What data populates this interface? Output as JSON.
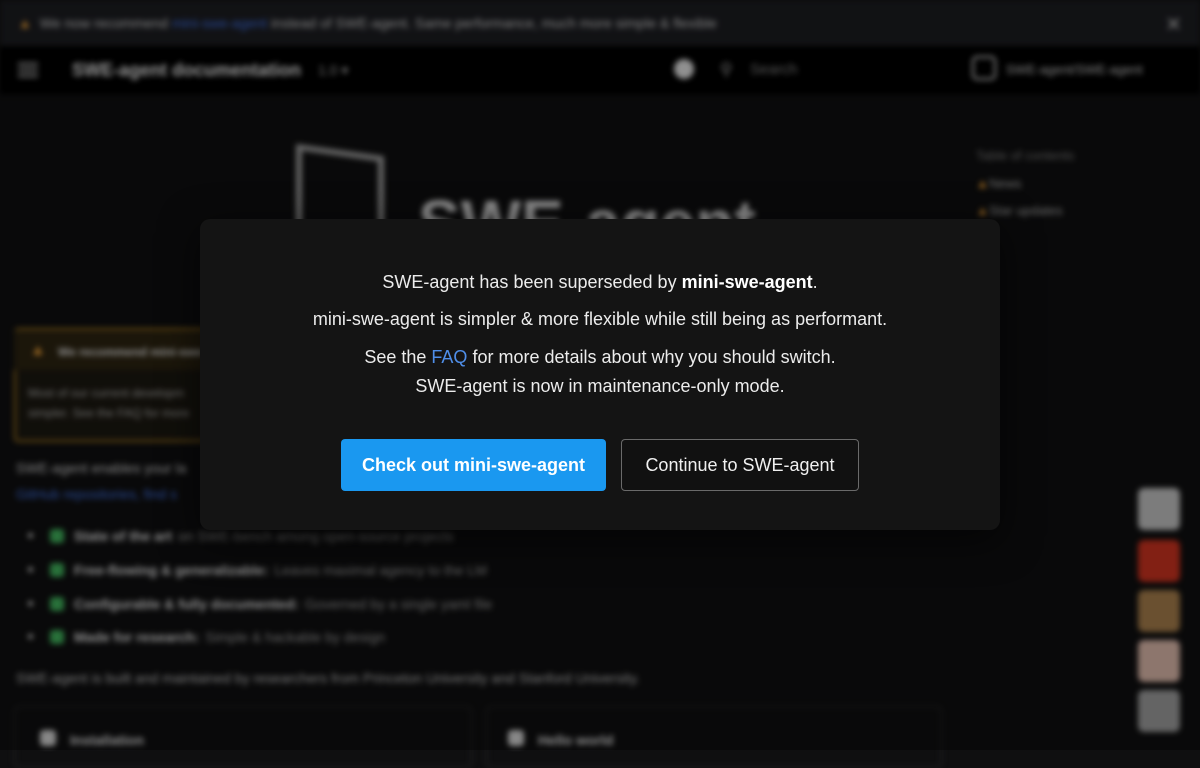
{
  "announcement": {
    "prefix": "We now recommend",
    "link": "mini-swe-agent",
    "suffix": "instead of SWE-agent. Same performance, much more simple & flexible",
    "close": "✕"
  },
  "header": {
    "title": "SWE-agent documentation",
    "version": "1.0 ▾",
    "search_placeholder": "Search",
    "repo": "SWE-agent/SWE-agent"
  },
  "hero": {
    "logo_text": "SWE-agent"
  },
  "toc": {
    "title": "Table of contents",
    "items": [
      "News",
      "Star updates"
    ]
  },
  "admonition": {
    "title": "We recommend mini-swe-agent",
    "line1": "Most of our current developm",
    "line2": "simpler. See the FAQ for more"
  },
  "intro": {
    "line1": "SWE-agent enables your la",
    "line2": "GitHub repositories, find s"
  },
  "features": [
    {
      "bold": "State of the art",
      "text": "on SWE-bench among open-source projects"
    },
    {
      "bold": "Free-flowing & generalizable:",
      "text": "Leaves maximal agency to the LM"
    },
    {
      "bold": "Configurable & fully documented:",
      "text": "Governed by a single yaml file"
    },
    {
      "bold": "Made for research:",
      "text": "Simple & hackable by design"
    }
  ],
  "built_by": "SWE-agent is built and maintained by researchers from Princeton University and Stanford University.",
  "cards": {
    "install": "Installation",
    "hello": "Hello world"
  },
  "modal": {
    "line1_pre": "SWE-agent has been superseded by ",
    "line1_bold": "mini-swe-agent",
    "line1_post": ".",
    "line2": "mini-swe-agent is simpler & more flexible while still being as performant.",
    "line3_pre": "See the ",
    "line3_link": "FAQ",
    "line3_post": " for more details about why you should switch.",
    "line4": "SWE-agent is now in maintenance-only mode.",
    "primary_button": "Check out mini-swe-agent",
    "secondary_button": "Continue to SWE-agent"
  },
  "colors": {
    "primary": "#1a98f0",
    "link": "#4f8ee8",
    "warning": "#e39a36"
  }
}
